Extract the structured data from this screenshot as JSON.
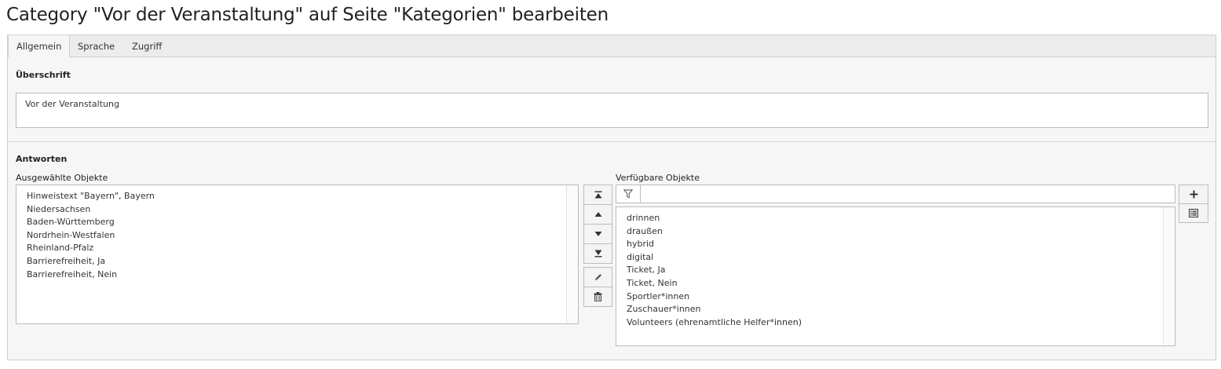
{
  "page": {
    "title": "Category \"Vor der Veranstaltung\" auf Seite \"Kategorien\" bearbeiten"
  },
  "tabs": [
    {
      "label": "Allgemein",
      "active": true
    },
    {
      "label": "Sprache",
      "active": false
    },
    {
      "label": "Zugriff",
      "active": false
    }
  ],
  "heading_section": {
    "label": "Überschrift",
    "value": "Vor der Veranstaltung"
  },
  "answers_section": {
    "label": "Antworten",
    "selected_label": "Ausgewählte Objekte",
    "available_label": "Verfügbare Objekte",
    "filter_placeholder": "",
    "selected_items": [
      "Hinweistext \"Bayern\", Bayern",
      "Niedersachsen",
      "Baden-Württemberg",
      "Nordrhein-Westfalen",
      "Rheinland-Pfalz",
      "Barrierefreiheit, Ja",
      "Barrierefreiheit, Nein"
    ],
    "available_items": [
      "drinnen",
      "draußen",
      "hybrid",
      "digital",
      "Ticket, Ja",
      "Ticket, Nein",
      "Sportler*innen",
      "Zuschauer*innen",
      "Volunteers (ehrenamtliche Helfer*innen)"
    ]
  },
  "icons": {
    "move_top": "move-to-top-icon",
    "move_up": "move-up-icon",
    "move_down": "move-down-icon",
    "move_bottom": "move-to-bottom-icon",
    "edit": "pencil-icon",
    "delete": "trash-icon",
    "filter": "filter-icon",
    "add": "plus-icon",
    "list": "list-icon"
  }
}
